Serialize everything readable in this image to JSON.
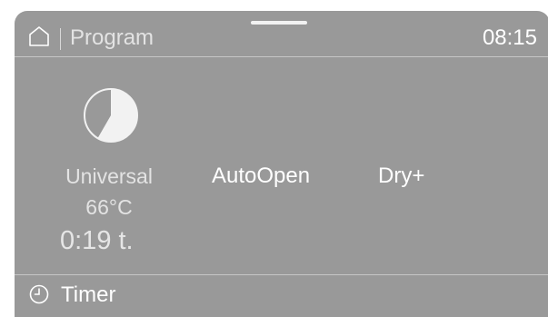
{
  "header": {
    "home_icon": "home-icon",
    "title": "Program",
    "time": "08:15"
  },
  "program": {
    "icon": "universal-program-icon",
    "name": "Universal",
    "temperature": "66°C",
    "duration": "0:19 t."
  },
  "options": [
    {
      "label": "AutoOpen"
    },
    {
      "label": "Dry+"
    }
  ],
  "footer": {
    "timer_icon": "clock-icon",
    "timer_label": "Timer"
  },
  "colors": {
    "screen_background": "#999999",
    "text_primary": "#ffffff",
    "text_secondary": "#e3e3e3",
    "divider": "#c6c6c6"
  }
}
